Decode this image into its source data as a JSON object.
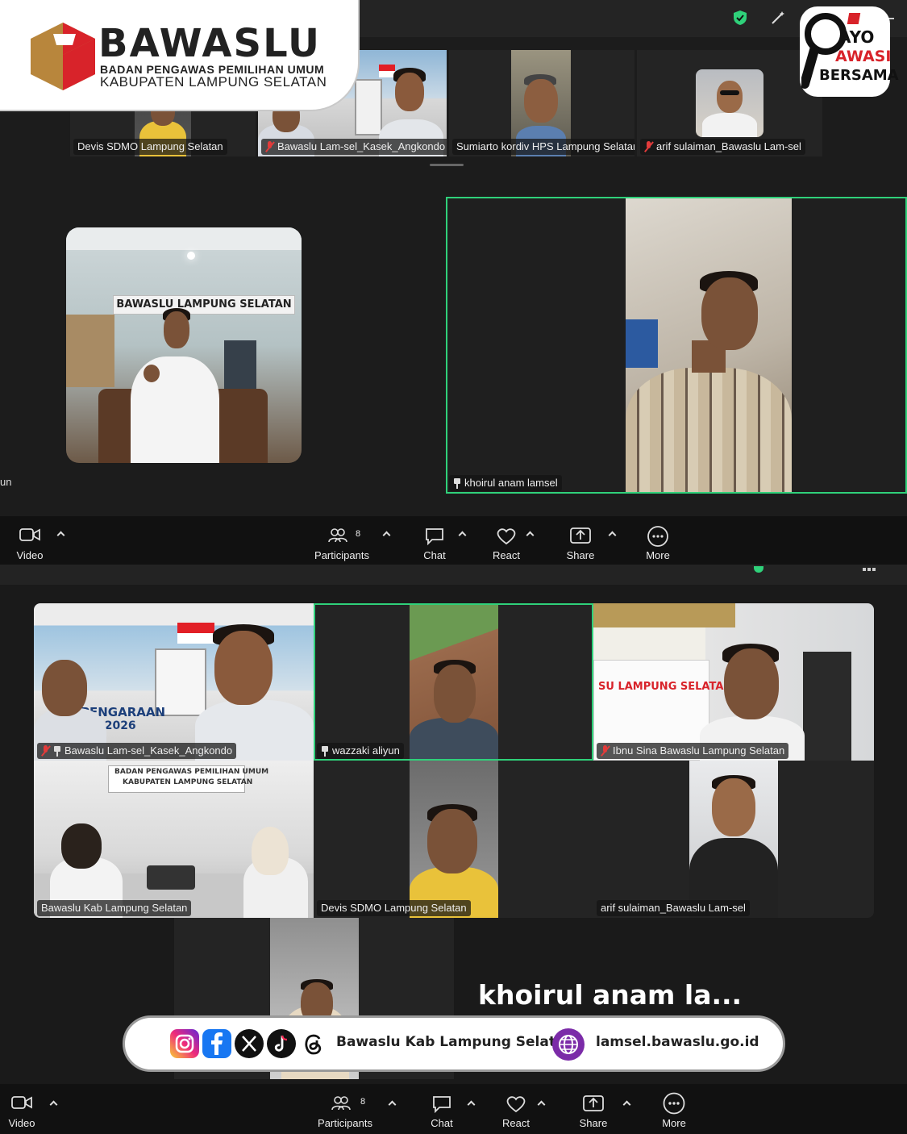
{
  "branding": {
    "org_name": "BAWASLU",
    "org_line1": "BADAN PENGAWAS PEMILIHAN UMUM",
    "org_line2": "KABUPATEN  LAMPUNG  SELATAN",
    "badge_line1": "AYO",
    "badge_line2": "AWASI",
    "badge_line3": "BERSAMA"
  },
  "top_meeting": {
    "thumbnails": [
      {
        "name": "Devis SDMO Lampung Selatan",
        "muted": false
      },
      {
        "name": "Bawaslu Lam-sel_Kasek_Angkondo",
        "muted": true
      },
      {
        "name": "Sumiarto kordiv HPS Lampung Selatan",
        "muted": false
      },
      {
        "name": "arif sulaiman_Bawaslu Lam-sel",
        "muted": true
      }
    ],
    "gallery_left_name": "un",
    "banner_text": "BAWASLU LAMPUNG SELATAN",
    "speaker_name": "khoirul anam lamsel",
    "toolbar": {
      "video": "Video",
      "participants": "Participants",
      "participants_count": "8",
      "chat": "Chat",
      "react": "React",
      "share": "Share",
      "more": "More"
    }
  },
  "bottom_meeting": {
    "tiles": [
      {
        "name": "Bawaslu Lam-sel_Kasek_Angkondo",
        "muted": true,
        "pinned": true
      },
      {
        "name": "wazzaki aliyun",
        "muted": false,
        "pinned": true
      },
      {
        "name": "Ibnu Sina Bawaslu Lampung Selatan",
        "muted": true,
        "pinned": false
      },
      {
        "name": "Bawaslu Kab Lampung Selatan",
        "muted": false,
        "pinned": false
      },
      {
        "name": "Devis SDMO Lampung Selatan",
        "muted": false,
        "pinned": false
      },
      {
        "name": "arif sulaiman_Bawaslu Lam-sel",
        "muted": false,
        "pinned": false
      }
    ],
    "tile_sign_1": "PENGARAAN",
    "tile_sign_2": "A 2026",
    "office_sign_1": "BADAN PENGAWAS PEMILIHAN UMUM",
    "office_sign_2": "KABUPATEN LAMPUNG SELATAN",
    "banner_sign": "SU LAMPUNG SELATAN",
    "speaker_caption": "khoirul  anam  la...",
    "toolbar": {
      "video": "Video",
      "participants": "Participants",
      "participants_count": "8",
      "chat": "Chat",
      "react": "React",
      "share": "Share",
      "more": "More"
    }
  },
  "social": {
    "handle": "Bawaslu Kab Lampung Selatan",
    "website": "lamsel.bawaslu.go.id",
    "icons": [
      "instagram-icon",
      "facebook-icon",
      "x-icon",
      "tiktok-icon",
      "threads-icon",
      "globe-icon"
    ]
  },
  "colors": {
    "active_speaker_border": "#2fd17a",
    "muted_red": "#e23b3b",
    "brand_red": "#d8232a",
    "brand_gold": "#b8863c"
  }
}
